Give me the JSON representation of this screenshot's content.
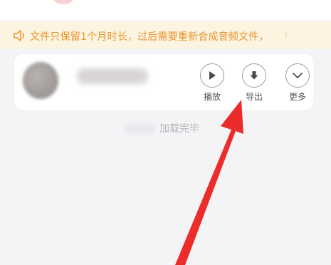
{
  "notice": {
    "text": "文件只保留1个月时长，过后需要重新合成音频文件，",
    "trail": "i"
  },
  "actions": {
    "play": "播放",
    "export": "导出",
    "more": "更多"
  },
  "status": {
    "loaded": "加载完毕"
  },
  "colors": {
    "notice_bg": "#fdf3e1",
    "notice_text": "#e8952b",
    "annotation_arrow": "#ec2b2b"
  },
  "icons": [
    "speaker-icon",
    "play-icon",
    "download-icon",
    "chevron-down-icon"
  ]
}
